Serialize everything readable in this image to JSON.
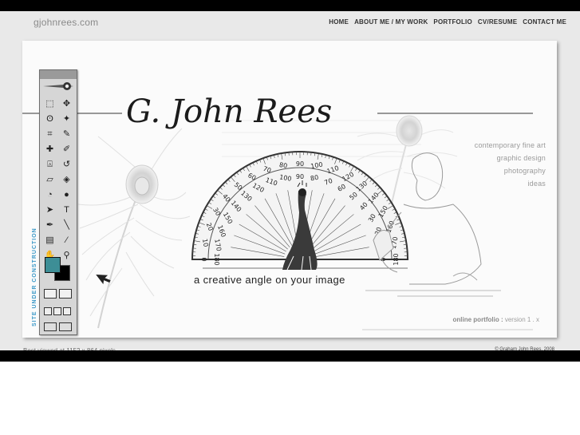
{
  "site": {
    "url": "gjohnrees.com"
  },
  "nav": {
    "items": [
      "HOME",
      "ABOUT ME / MY WORK",
      "PORTFOLIO",
      "CV/RESUME",
      "CONTACT ME"
    ]
  },
  "hero": {
    "title": "G. John Rees",
    "tagline": "a creative angle on your image",
    "protractor_outer_labels": [
      "0",
      "10",
      "20",
      "30",
      "40",
      "50",
      "60",
      "70",
      "80",
      "90",
      "100",
      "110",
      "120",
      "130",
      "140",
      "150",
      "160",
      "170",
      "180"
    ],
    "protractor_inner_labels": [
      "180",
      "170",
      "160",
      "150",
      "140",
      "130",
      "120",
      "110",
      "100",
      "90",
      "80",
      "70",
      "60",
      "50",
      "40",
      "30",
      "20",
      "10",
      "0"
    ]
  },
  "menu": {
    "items": [
      "contemporary fine art",
      "graphic design",
      "photography",
      "ideas"
    ]
  },
  "version": {
    "label": "online portfolio :",
    "value": "version 1 . x"
  },
  "sidebar": {
    "vertical_label": "SITE UNDER CONSTRUCTION"
  },
  "footer": {
    "left": "Best viewed at 1152 x 864 pixels",
    "right": "© Graham John Rees, 2008"
  },
  "colors": {
    "frame": "#e9e9e9",
    "accent_blue": "#3b98c7",
    "swatch_fg": "#3d8e96"
  },
  "icons": {
    "toolbox": [
      "marquee-icon",
      "move-icon",
      "lasso-icon",
      "magic-wand-icon",
      "crop-icon",
      "slice-icon",
      "healing-icon",
      "brush-icon",
      "stamp-icon",
      "history-brush-icon",
      "eraser-icon",
      "bucket-icon",
      "blur-icon",
      "dodge-icon",
      "path-select-icon",
      "type-icon",
      "pen-icon",
      "line-icon",
      "notes-icon",
      "eyedropper-icon",
      "hand-icon",
      "zoom-icon"
    ]
  }
}
